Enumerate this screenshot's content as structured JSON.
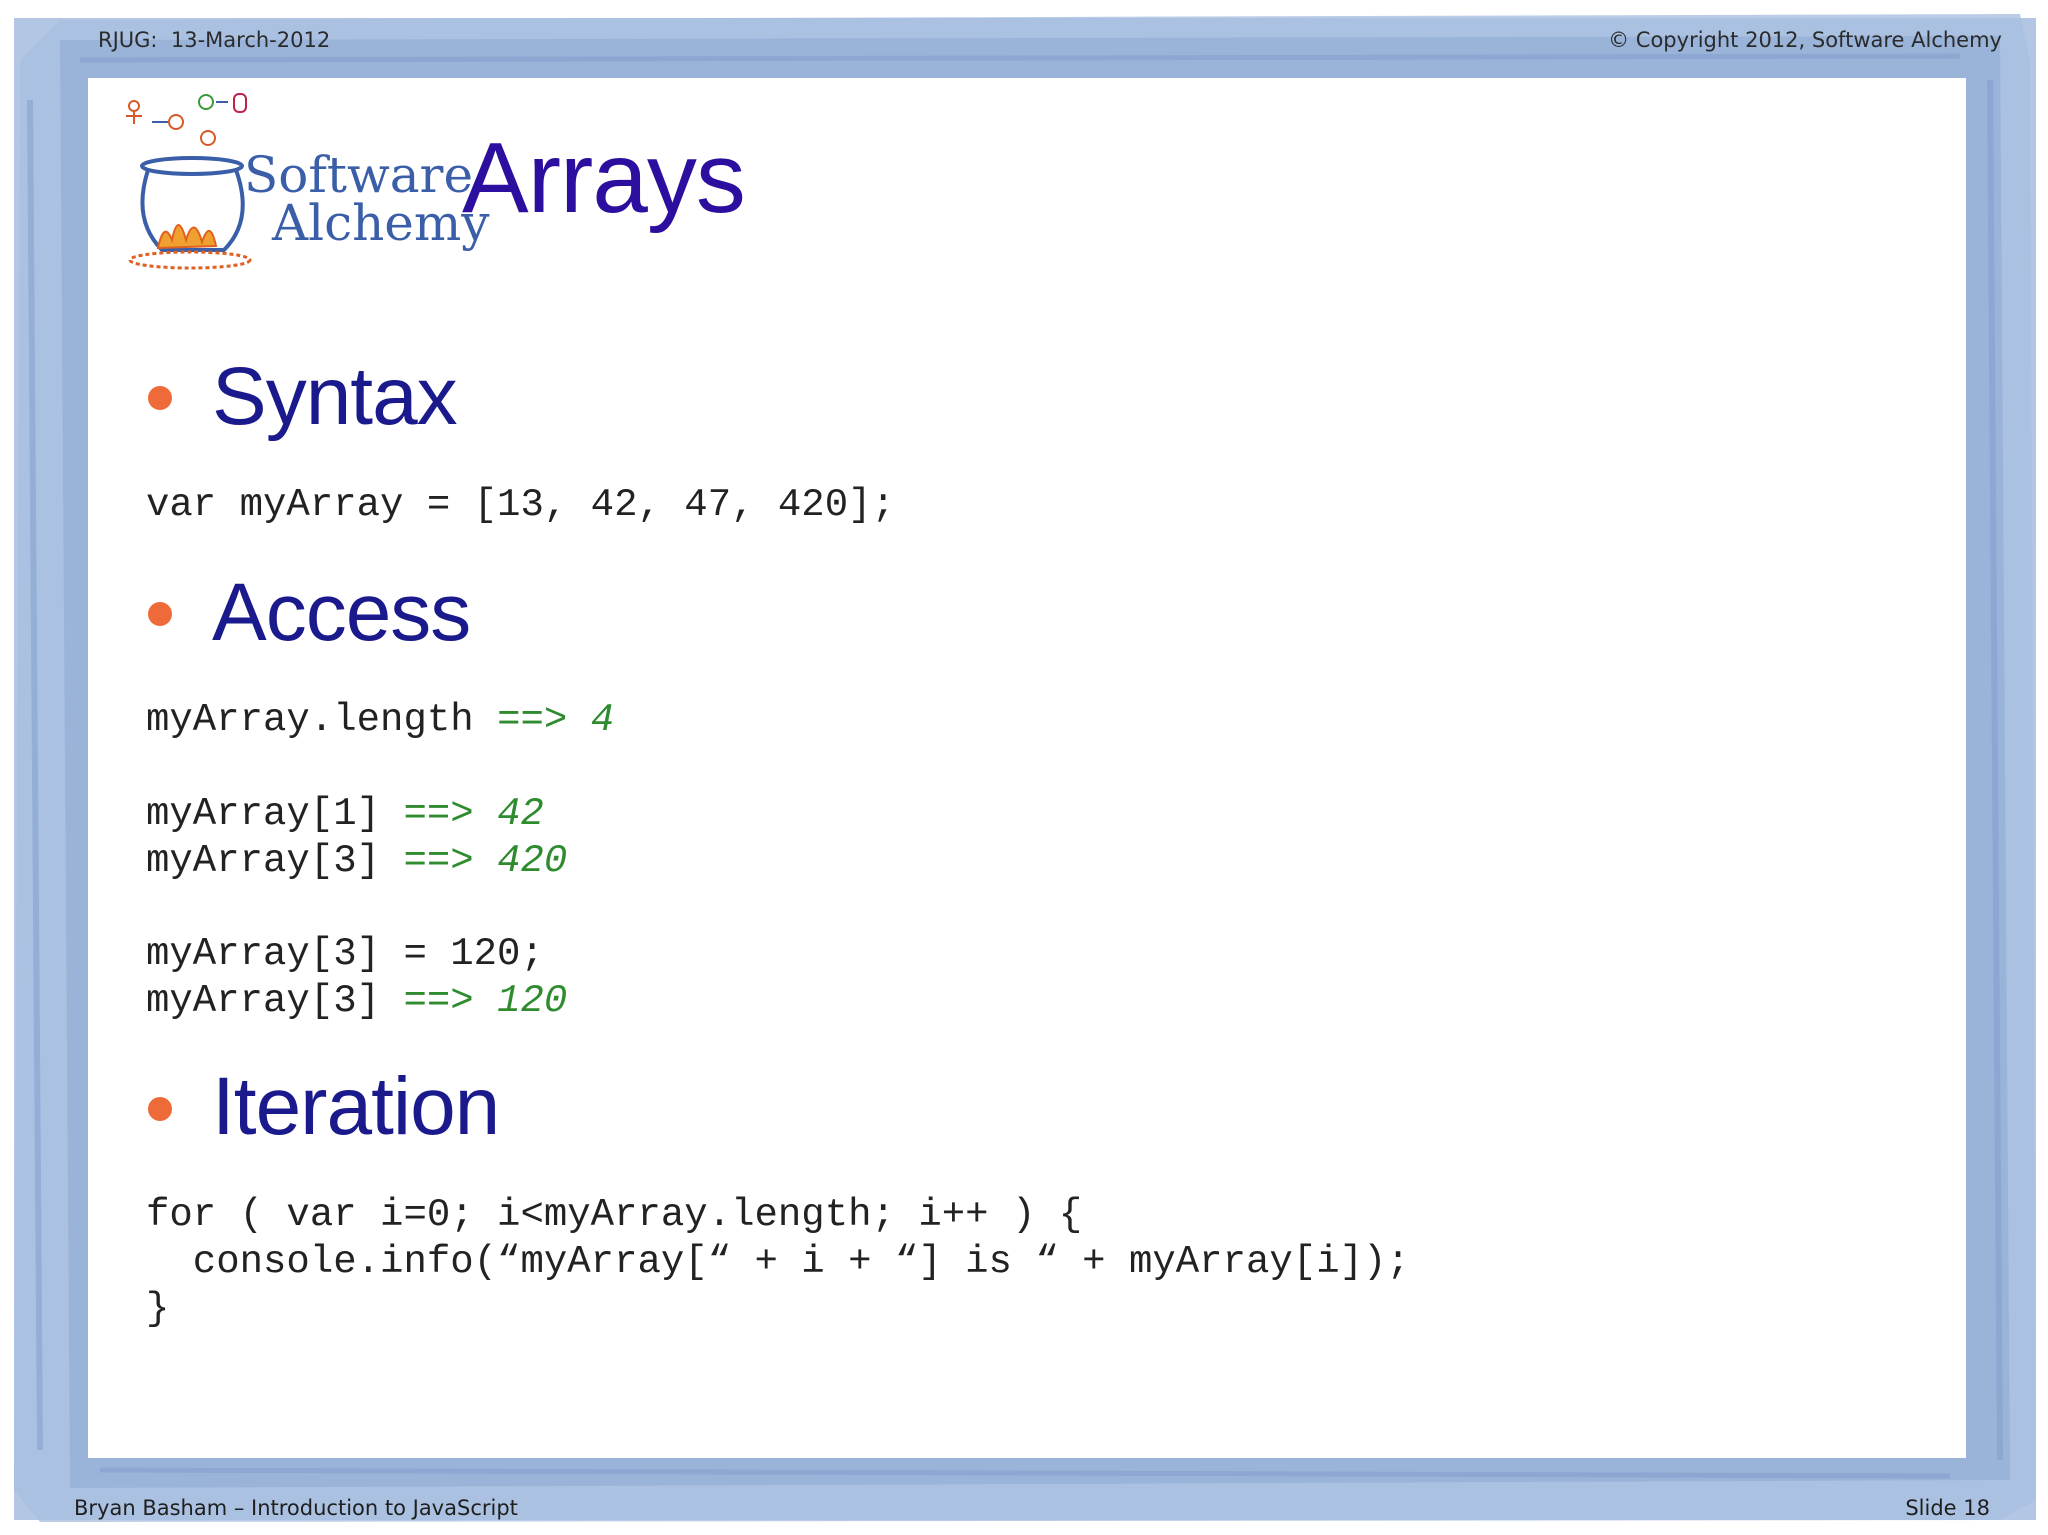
{
  "header": {
    "left": "RJUG:  13-March-2012",
    "right": "© Copyright 2012, Software Alchemy"
  },
  "footer": {
    "left": "Bryan Basham – Introduction to JavaScript",
    "right": "Slide 18"
  },
  "logo": {
    "line1": "Software",
    "line2": "Alchemy"
  },
  "title": "Arrays",
  "sections": [
    {
      "heading": "Syntax"
    },
    {
      "heading": "Access"
    },
    {
      "heading": "Iteration"
    }
  ],
  "code": {
    "syntax": "var myArray = [13, 42, 47, 420];",
    "access": [
      {
        "code": "myArray.length ",
        "arrow": "==>",
        "result": " 4"
      },
      {
        "code": "myArray[1] ",
        "arrow": "==>",
        "result": " 42"
      },
      {
        "code": "myArray[3] ",
        "arrow": "==>",
        "result": " 420"
      },
      {
        "code": "myArray[3] = 120;"
      },
      {
        "code": "myArray[3] ",
        "arrow": "==>",
        "result": " 120"
      }
    ],
    "iteration": [
      "for ( var i=0; i<myArray.length; i++ ) {",
      "  console.info(“myArray[“ + i + “] is “ + myArray[i]);",
      "}"
    ]
  },
  "colors": {
    "title": "#2d0fa0",
    "heading": "#1a1a8c",
    "bullet": "#ee6a38",
    "comment": "#2e8b2e",
    "frame": "#b3c7e4"
  }
}
